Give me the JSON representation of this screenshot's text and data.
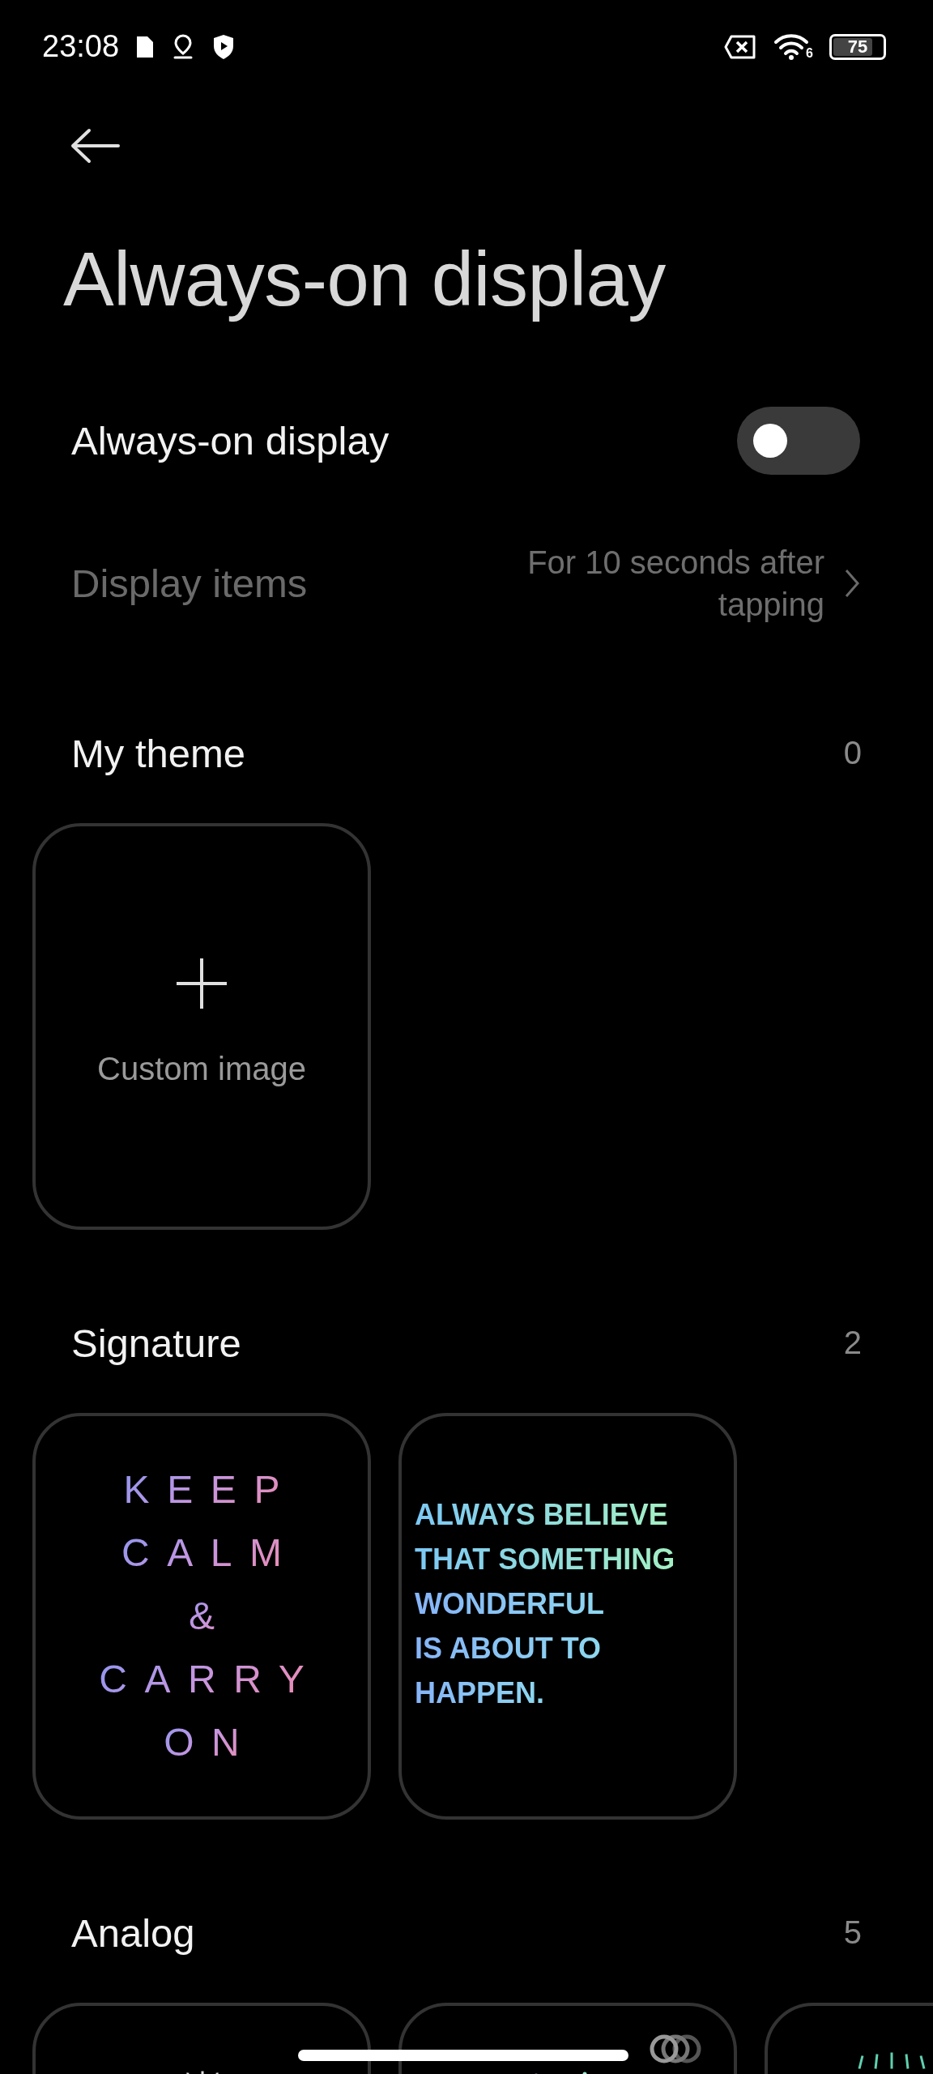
{
  "status_bar": {
    "time": "23:08",
    "wifi_badge": "6",
    "battery": "75"
  },
  "title": "Always-on display",
  "settings": [
    {
      "kind": "toggle",
      "label": "Always-on display",
      "on": false,
      "disabled": false
    },
    {
      "kind": "link",
      "label": "Display items",
      "value": "For 10 seconds after tapping",
      "disabled": true
    }
  ],
  "sections": [
    {
      "title": "My theme",
      "count": "0",
      "cards": [
        {
          "kind": "add",
          "label": "Custom image"
        }
      ]
    },
    {
      "title": "Signature",
      "count": "2",
      "cards": [
        {
          "kind": "spaced_quote",
          "lines": [
            "KEEP",
            "CALM",
            "&",
            "CARRY",
            "ON"
          ]
        },
        {
          "kind": "bold_quote",
          "lines": [
            "ALWAYS BELIEVE",
            "THAT SOMETHING",
            "WONDERFUL",
            "IS ABOUT TO",
            "HAPPEN."
          ]
        }
      ]
    },
    {
      "title": "Analog",
      "count": "5",
      "cards": [
        {
          "kind": "clock"
        },
        {
          "kind": "clock_rings"
        },
        {
          "kind": "clock"
        }
      ]
    }
  ]
}
